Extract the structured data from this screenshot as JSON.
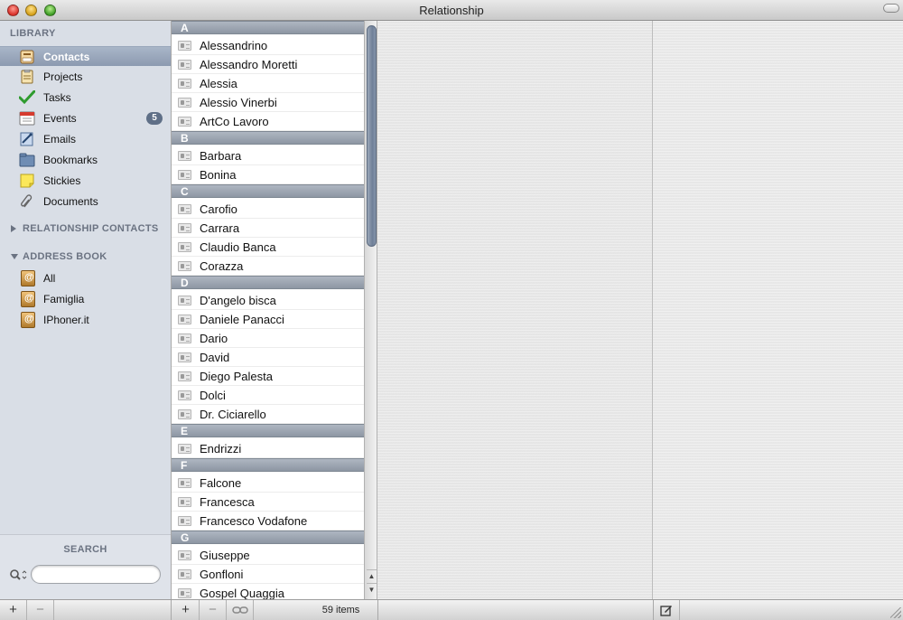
{
  "window": {
    "title": "Relationship"
  },
  "sidebar": {
    "library_header": "LIBRARY",
    "library_items": [
      {
        "label": "Contacts",
        "icon": "contacts-icon",
        "selected": true
      },
      {
        "label": "Projects",
        "icon": "projects-icon"
      },
      {
        "label": "Tasks",
        "icon": "tasks-checkmark-icon"
      },
      {
        "label": "Events",
        "icon": "calendar-icon",
        "badge": "5"
      },
      {
        "label": "Emails",
        "icon": "email-icon"
      },
      {
        "label": "Bookmarks",
        "icon": "bookmarks-icon"
      },
      {
        "label": "Stickies",
        "icon": "sticky-note-icon"
      },
      {
        "label": "Documents",
        "icon": "paperclip-icon"
      }
    ],
    "relationship_contacts_header": "RELATIONSHIP CONTACTS",
    "address_book_header": "ADDRESS BOOK",
    "address_book_items": [
      {
        "label": "All"
      },
      {
        "label": "Famiglia"
      },
      {
        "label": "IPhoner.it"
      }
    ],
    "search_title": "SEARCH",
    "search_placeholder": ""
  },
  "contacts": {
    "sections": [
      {
        "letter": "A",
        "names": [
          "Alessandrino",
          "Alessandro Moretti",
          "Alessia",
          "Alessio Vinerbi",
          "ArtCo Lavoro"
        ]
      },
      {
        "letter": "B",
        "names": [
          "Barbara",
          "Bonina"
        ]
      },
      {
        "letter": "C",
        "names": [
          "Carofio",
          "Carrara",
          "Claudio Banca",
          "Corazza"
        ]
      },
      {
        "letter": "D",
        "names": [
          "D'angelo bisca",
          "Daniele Panacci",
          "Dario",
          "David",
          "Diego Palesta",
          "Dolci",
          "Dr. Ciciarello"
        ]
      },
      {
        "letter": "E",
        "names": [
          "Endrizzi"
        ]
      },
      {
        "letter": "F",
        "names": [
          "Falcone",
          "Francesca",
          "Francesco Vodafone"
        ]
      },
      {
        "letter": "G",
        "names": [
          "Giuseppe",
          "Gonfloni",
          "Gospel Quaggia"
        ]
      }
    ]
  },
  "bottombar": {
    "add": "+",
    "remove": "−",
    "items_count": "59 items"
  },
  "colors": {
    "selection": "#8c9ab0",
    "badge": "#5f6f87",
    "section_header": "#9aa3ae"
  }
}
